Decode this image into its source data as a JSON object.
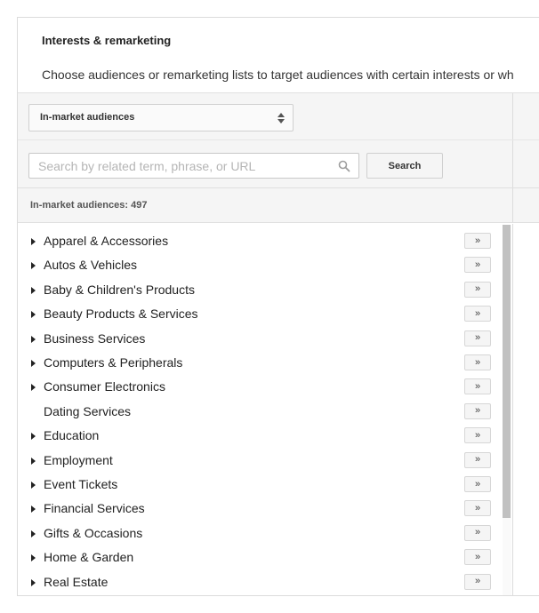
{
  "header": {
    "title": "Interests & remarketing",
    "description": "Choose audiences or remarketing lists to target audiences with certain interests or wh"
  },
  "audience_select": {
    "selected": "In-market audiences"
  },
  "search": {
    "placeholder": "Search by related term, phrase, or URL",
    "button_label": "Search"
  },
  "count_label": "In-market audiences: 497",
  "list": {
    "add_button_label": "»",
    "items": [
      {
        "label": "Apparel & Accessories",
        "expandable": true
      },
      {
        "label": "Autos & Vehicles",
        "expandable": true
      },
      {
        "label": "Baby & Children's Products",
        "expandable": true
      },
      {
        "label": "Beauty Products & Services",
        "expandable": true
      },
      {
        "label": "Business Services",
        "expandable": true
      },
      {
        "label": "Computers & Peripherals",
        "expandable": true
      },
      {
        "label": "Consumer Electronics",
        "expandable": true
      },
      {
        "label": "Dating Services",
        "expandable": false
      },
      {
        "label": "Education",
        "expandable": true
      },
      {
        "label": "Employment",
        "expandable": true
      },
      {
        "label": "Event Tickets",
        "expandable": true
      },
      {
        "label": "Financial Services",
        "expandable": true
      },
      {
        "label": "Gifts & Occasions",
        "expandable": true
      },
      {
        "label": "Home & Garden",
        "expandable": true
      },
      {
        "label": "Real Estate",
        "expandable": true
      }
    ]
  },
  "icons": {
    "select_arrows": "up-down-arrows-icon",
    "search": "search-icon",
    "row_caret": "caret-right-icon"
  },
  "colors": {
    "band_background": "#f5f5f5",
    "border": "#dcdcdc",
    "scrollbar_thumb": "#c1c1c1"
  }
}
